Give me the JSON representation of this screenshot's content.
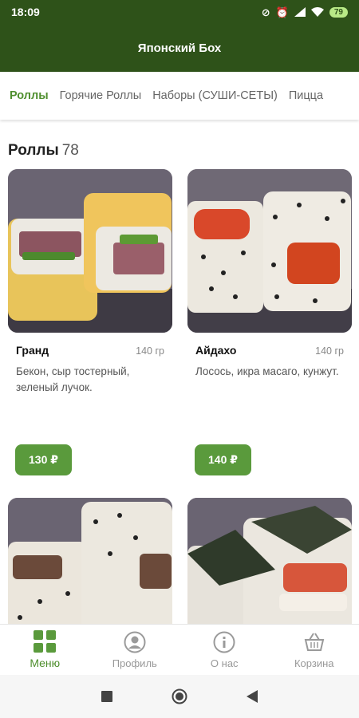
{
  "status_bar": {
    "time": "18:09",
    "battery": "79"
  },
  "app_bar": {
    "title": "Японский Бох"
  },
  "tabs": [
    {
      "label": "Роллы",
      "active": true
    },
    {
      "label": "Горячие Роллы",
      "active": false
    },
    {
      "label": "Наборы (СУШИ-СЕТЫ)",
      "active": false
    },
    {
      "label": "Пицца",
      "active": false
    }
  ],
  "section": {
    "title": "Роллы",
    "count": "78"
  },
  "products": [
    {
      "name": "Гранд",
      "weight": "140 гр",
      "description": "Бекон, сыр тостерный, зеленый лучок.",
      "price": "130 ₽"
    },
    {
      "name": "Айдахо",
      "weight": "140 гр",
      "description": "Лосось, икра масаго, кунжут.",
      "price": "140 ₽"
    }
  ],
  "bottom_nav": [
    {
      "label": "Меню",
      "icon": "grid-icon",
      "active": true
    },
    {
      "label": "Профиль",
      "icon": "profile-icon",
      "active": false
    },
    {
      "label": "О нас",
      "icon": "info-icon",
      "active": false
    },
    {
      "label": "Корзина",
      "icon": "basket-icon",
      "active": false
    }
  ],
  "colors": {
    "header": "#2e5219",
    "accent": "#4f8f2e",
    "price_button": "#5a9a3c"
  }
}
